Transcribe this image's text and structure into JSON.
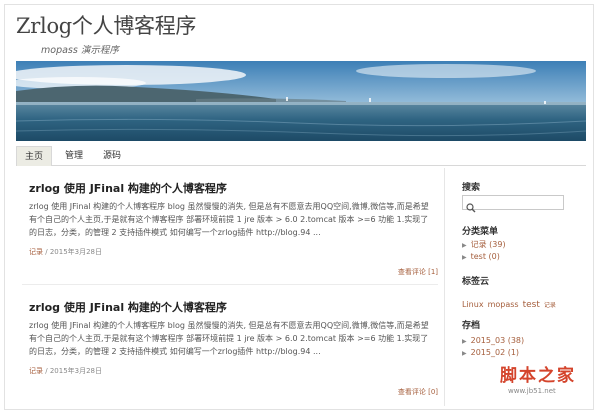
{
  "site": {
    "title": "Zrlog个人博客程序",
    "description": "mopass 演示程序"
  },
  "nav": {
    "items": [
      {
        "label": "主页"
      },
      {
        "label": "管理"
      },
      {
        "label": "源码"
      }
    ]
  },
  "posts": [
    {
      "title": "zrlog 使用 JFinal 构建的个人博客程序",
      "body": "zrlog 使用 JFinal 构建的个人博客程序 blog 虽然慢慢的消失, 但是总有不愿意去用QQ空间,微博,微信等,而是希望有个自己的个人主页,于是就有这个博客程序 部署环境前提 1 jre 版本 > 6.0 2.tomcat 版本 >=6 功能 1.实现了的日志，分类，的管理 2 支持插件模式 如何编写一个zrlog插件 http://blog.94 ...",
      "category": "记录",
      "date": "2015年3月28日",
      "comments": "查看评论 [1]"
    },
    {
      "title": "zrlog 使用 JFinal 构建的个人博客程序",
      "body": "zrlog 使用 JFinal 构建的个人博客程序 blog 虽然慢慢的消失, 但是总有不愿意去用QQ空间,微博,微信等,而是希望有个自己的个人主页,于是就有这个博客程序 部署环境前提 1 jre 版本 > 6.0 2.tomcat 版本 >=6 功能 1.实现了的日志，分类，的管理 2 支持插件模式 如何编写一个zrlog插件 http://blog.94 ...",
      "category": "记录",
      "date": "2015年3月28日",
      "comments": "查看评论 [0]"
    }
  ],
  "sidebar": {
    "search_heading": "搜索",
    "categories_heading": "分类菜单",
    "categories": [
      {
        "label": "记录 (39)"
      },
      {
        "label": "test (0)"
      }
    ],
    "tags_heading": "标签云",
    "tags": [
      {
        "label": "Linux"
      },
      {
        "label": "mopass"
      },
      {
        "label": "test"
      },
      {
        "label": "记录"
      }
    ],
    "archive_heading": "存档",
    "archives": [
      {
        "label": "2015_03 (38)"
      },
      {
        "label": "2015_02 (1)"
      }
    ]
  },
  "watermark": {
    "text": "脚本之家",
    "url": "www.jb51.net"
  },
  "colors": {
    "link": "#a55e3c",
    "nav_active": "#ecece4",
    "watermark": "#d4442c"
  },
  "icons": {
    "search": "search-icon",
    "list_bullet": "triangle-right-icon"
  }
}
